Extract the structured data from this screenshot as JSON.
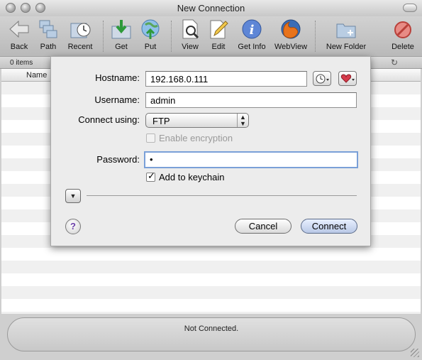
{
  "window": {
    "title": "New Connection"
  },
  "toolbar": {
    "buttons": [
      {
        "label": "Back",
        "icon": "back-arrow-icon"
      },
      {
        "label": "Path",
        "icon": "path-folders-icon"
      },
      {
        "label": "Recent",
        "icon": "recent-clock-icon"
      },
      {
        "label": "Get",
        "icon": "get-download-icon"
      },
      {
        "label": "Put",
        "icon": "put-upload-globe-icon"
      },
      {
        "label": "View",
        "icon": "view-document-icon"
      },
      {
        "label": "Edit",
        "icon": "edit-pencil-icon"
      },
      {
        "label": "Get Info",
        "icon": "info-icon"
      },
      {
        "label": "WebView",
        "icon": "firefox-browser-icon"
      },
      {
        "label": "New Folder",
        "icon": "new-folder-icon"
      },
      {
        "label": "Delete",
        "icon": "delete-icon"
      }
    ]
  },
  "browser": {
    "item_count": "0 items",
    "column_name": "Name",
    "status": "Not Connected."
  },
  "dialog": {
    "hostname_label": "Hostname:",
    "hostname_value": "192.168.0.111",
    "username_label": "Username:",
    "username_value": "admin",
    "connect_using_label": "Connect using:",
    "connect_using_value": "FTP",
    "enable_encryption_label": "Enable encryption",
    "password_label": "Password:",
    "password_value": "•",
    "add_to_keychain_label": "Add to keychain",
    "cancel_label": "Cancel",
    "connect_label": "Connect",
    "help_glyph": "?"
  }
}
